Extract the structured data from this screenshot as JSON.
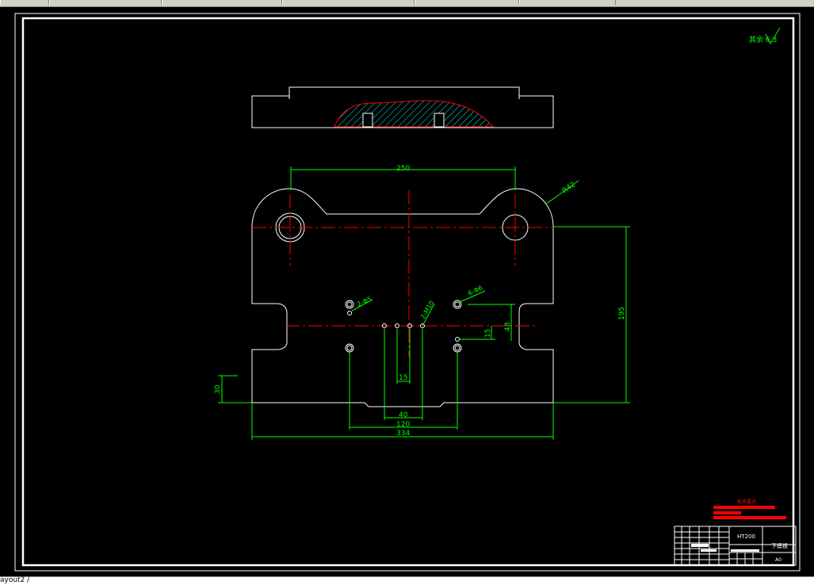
{
  "window": {
    "layout_tab_label": "ayout2 /"
  },
  "drawing": {
    "roughness_note": "其余 6.3",
    "dims": {
      "d250": "250",
      "r42": "R42",
      "d195": "195",
      "d48": "48",
      "d15v": "15",
      "d15h": "15",
      "d40": "40",
      "d120": "120",
      "d334": "334",
      "d30": "30"
    },
    "hole_labels": {
      "h1": "2-Φ5",
      "h2": "2-M10",
      "h3": "6-Φ6"
    }
  },
  "title_block": {
    "heading": "技术要求",
    "material": "HT200",
    "part_name": "下模板",
    "scale": "A0"
  },
  "colors": {
    "background": "#000000",
    "outline": "#ffffff",
    "dimension": "#00ff00",
    "centerline": "#ff0000",
    "hatch": "#00ffff",
    "title_red": "#ff0000"
  }
}
